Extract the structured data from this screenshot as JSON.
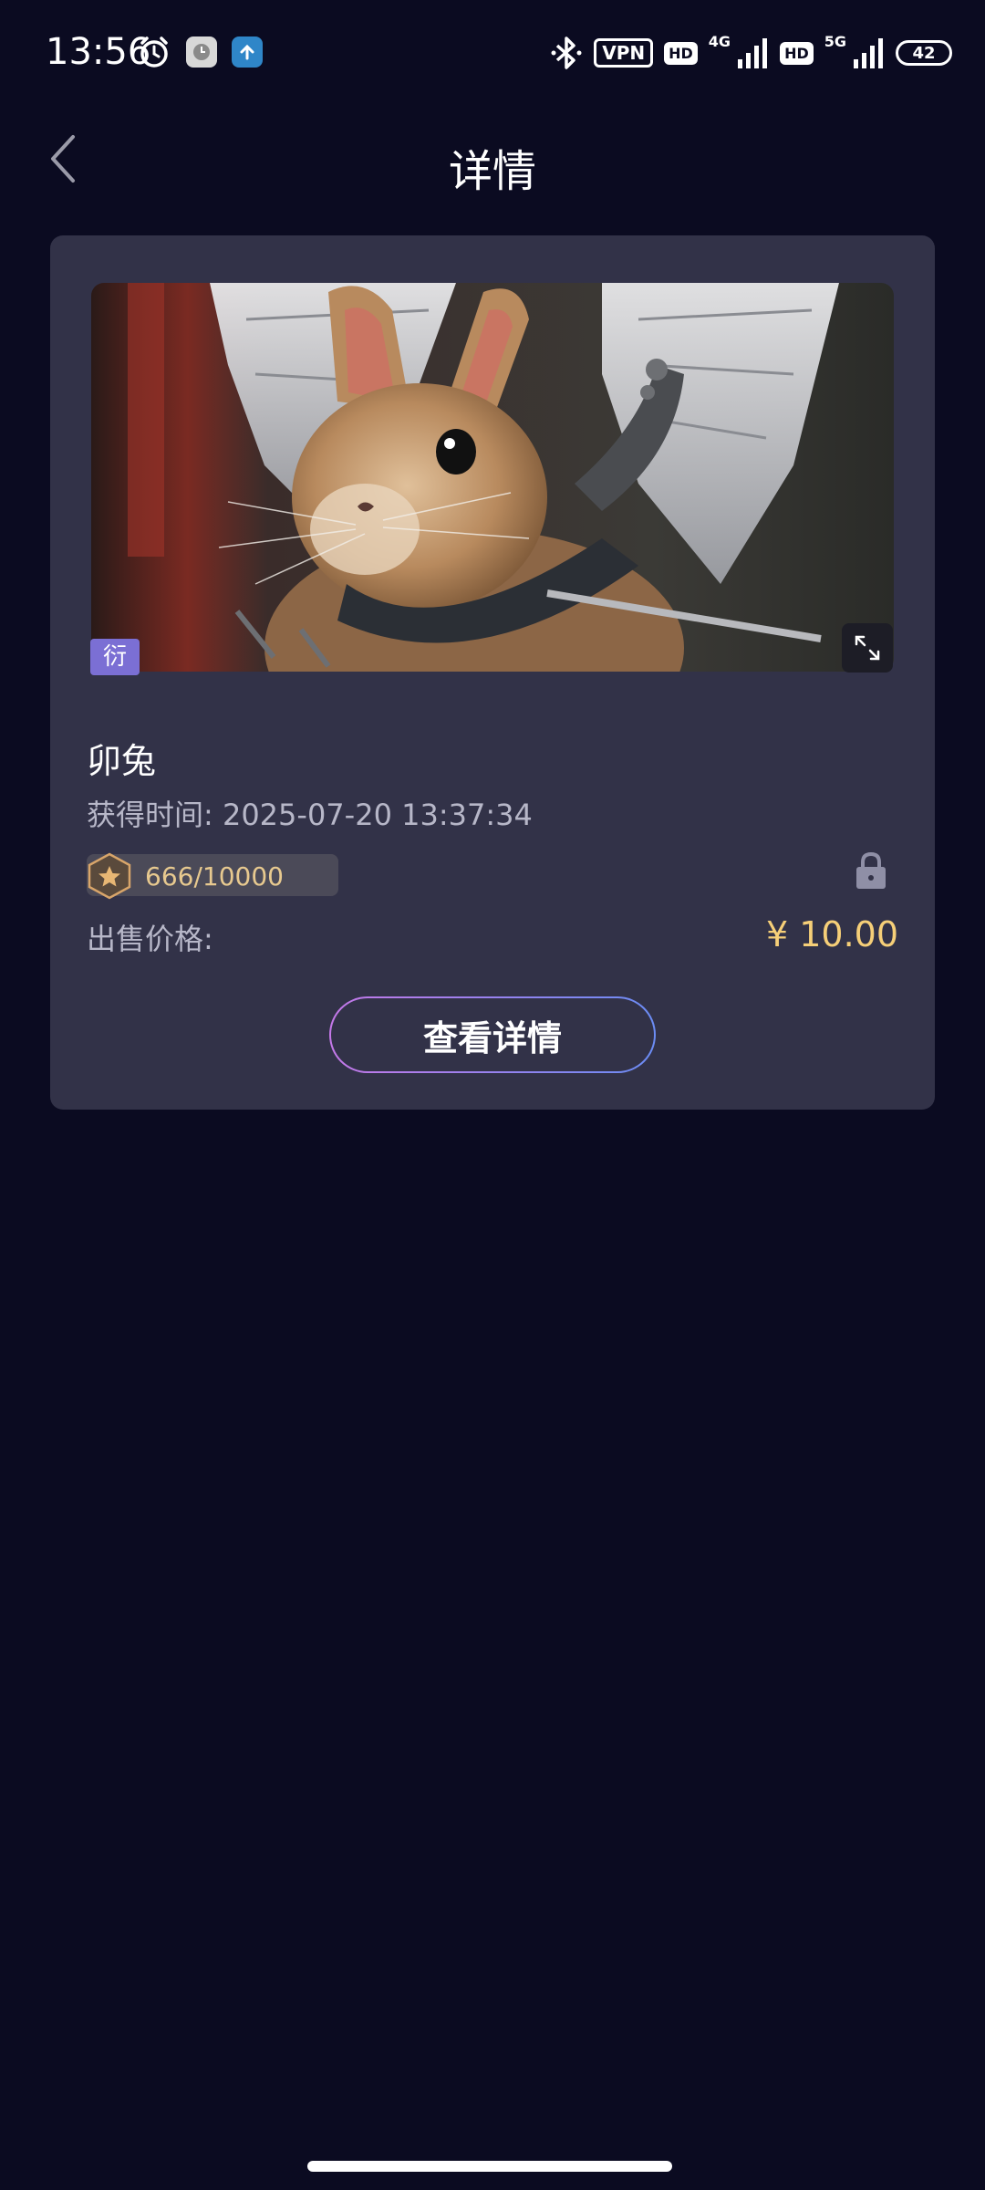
{
  "status_bar": {
    "time": "13:56",
    "vpn": "VPN",
    "hd1": "HD",
    "net1": "4G",
    "hd2": "HD",
    "net2": "5G",
    "battery": "42"
  },
  "header": {
    "title": "详情"
  },
  "card": {
    "tag": "衍",
    "name": "卯兔",
    "acquire_label": "获得时间: 2025-07-20 13:37:34",
    "serial": "666/10000",
    "price_label": "出售价格:",
    "price_value": "¥ 10.00",
    "button_label": "查看详情"
  },
  "colors": {
    "background": "#0b0b21",
    "card": "#323248",
    "price": "#f6cf78",
    "tag": "#7b6fd4",
    "button_gradient_start": "#c478e8",
    "button_gradient_end": "#6b8cf4"
  }
}
